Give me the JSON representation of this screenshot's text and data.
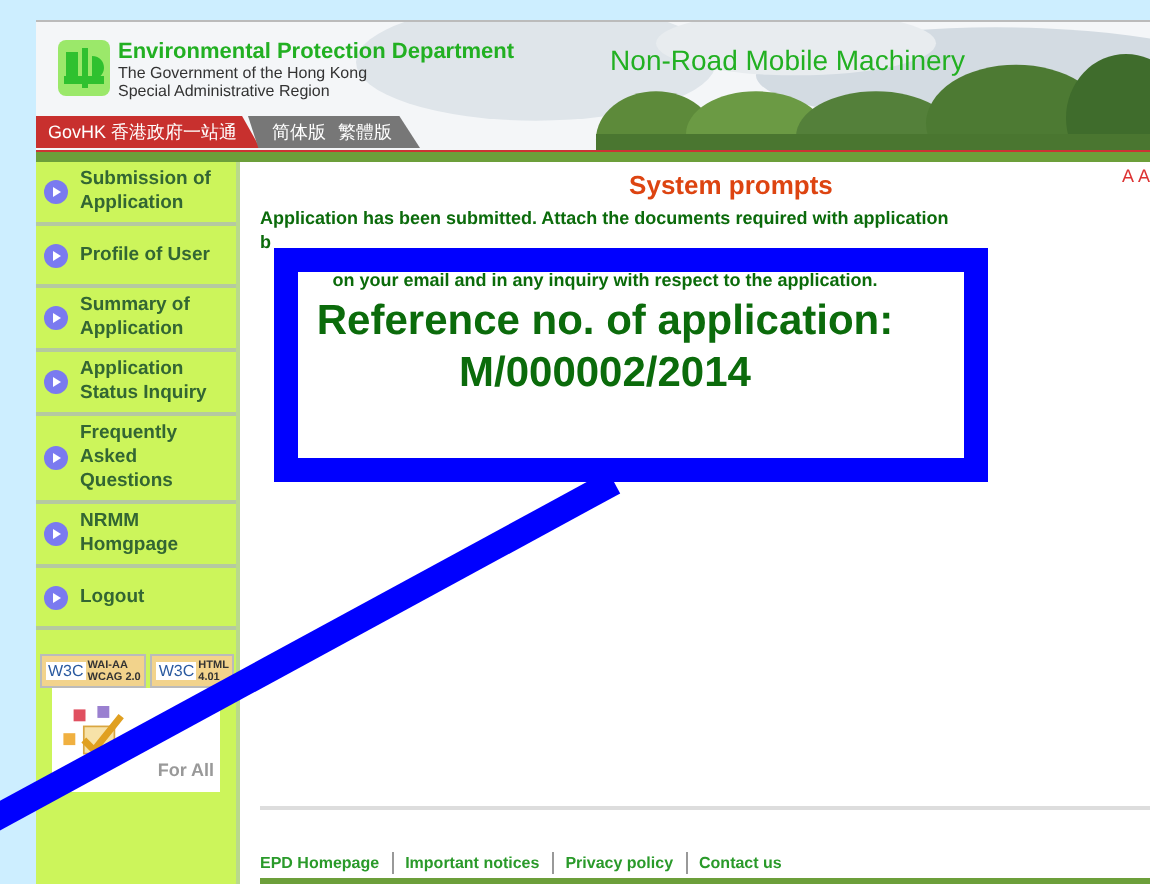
{
  "header": {
    "department": "Environmental Protection Department",
    "government_lines": [
      "The Government of the Hong Kong",
      "Special Administrative Region"
    ],
    "site_title": "Non-Road Mobile Machinery",
    "nav": [
      {
        "label": "GovHK 香港政府一站通",
        "kind": "govhk"
      },
      {
        "label": "简体版",
        "kind": "lang"
      },
      {
        "label": "繁體版",
        "kind": "lang"
      }
    ]
  },
  "sidebar": {
    "items": [
      "Submission of Application",
      "Profile of User",
      "Summary of Application",
      "Application Status Inquiry",
      "Frequently Asked Questions",
      "NRMM Homgpage",
      "Logout"
    ],
    "badges": [
      {
        "mark": "W3C",
        "lines": [
          "WAI-AA",
          "WCAG 2.0"
        ]
      },
      {
        "mark": "W3C",
        "lines": [
          "HTML",
          "4.01"
        ]
      }
    ],
    "web_for_all": "For All"
  },
  "main": {
    "title": "System prompts",
    "text_size_links": [
      "A",
      "A"
    ],
    "message_lines": [
      "Application has been submitted. Attach the documents required with application",
      "b",
      "on your email and in any inquiry with respect to the application."
    ],
    "reference_label": "Reference no. of application:",
    "reference_number": "M/000002/2014"
  },
  "footer": {
    "links": [
      "EPD Homepage",
      "Important notices",
      "Privacy policy",
      "Contact us"
    ]
  }
}
